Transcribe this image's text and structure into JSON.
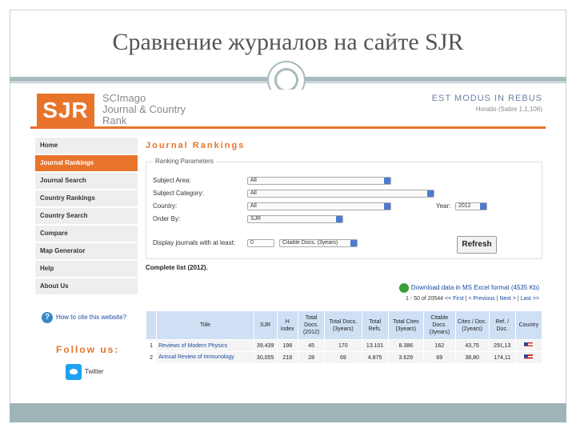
{
  "slide": {
    "title": "Сравнение журналов на сайте SJR"
  },
  "site": {
    "logo": "SJR",
    "logo_text": [
      "SCImago",
      "Journal & Country",
      "Rank"
    ],
    "motto": "EST MODUS IN REBUS",
    "lang": "Horatio (Satire 1,1,106)"
  },
  "nav": [
    {
      "label": "Home",
      "active": false
    },
    {
      "label": "Journal Rankings",
      "active": true
    },
    {
      "label": "Journal Search",
      "active": false
    },
    {
      "label": "Country Rankings",
      "active": false
    },
    {
      "label": "Country Search",
      "active": false
    },
    {
      "label": "Compare",
      "active": false
    },
    {
      "label": "Map Generator",
      "active": false
    },
    {
      "label": "Help",
      "active": false
    },
    {
      "label": "About Us",
      "active": false
    }
  ],
  "sidebar": {
    "cite": "How to cite this website?",
    "follow": "Follow us:",
    "twitter": "Twitter"
  },
  "main": {
    "title": "Journal Rankings",
    "params_legend": "Ranking Parameters",
    "subject_area_label": "Subject Area:",
    "subject_area_value": "All",
    "subject_category_label": "Subject Category:",
    "subject_category_value": "All",
    "country_label": "Country:",
    "country_value": "All",
    "year_label": "Year:",
    "year_value": "2012",
    "order_label": "Order By:",
    "order_value": "SJR",
    "display_label": "Display journals with at least:",
    "display_value": "0",
    "display_unit": "Citable Docs. (3years)",
    "refresh": "Refresh",
    "complete": "Complete list (2012).",
    "download": "Download data in MS Excel format (4535 Kb)",
    "pager_range": "1 - 50 of 20544",
    "pager_first": "<< First",
    "pager_prev": "< Previous",
    "pager_next": "Next >",
    "pager_last": "Last >>"
  },
  "table": {
    "headers": [
      "",
      "Title",
      "SJR",
      "H index",
      "Total Docs. (2012)",
      "Total Docs. (3years)",
      "Total Refs.",
      "Total Cites (3years)",
      "Citable Docs. (3years)",
      "Cites / Doc. (2years)",
      "Ref. / Doc.",
      "Country"
    ],
    "rows": [
      [
        "1",
        "Reviews of Modern Physics",
        "39,439",
        "198",
        "45",
        "170",
        "13.101",
        "8.386",
        "162",
        "43,75",
        "291,13"
      ],
      [
        "2",
        "Annual Review of Immunology",
        "30,055",
        "218",
        "28",
        "69",
        "4.875",
        "3.629",
        "69",
        "38,80",
        "174,11"
      ]
    ]
  }
}
